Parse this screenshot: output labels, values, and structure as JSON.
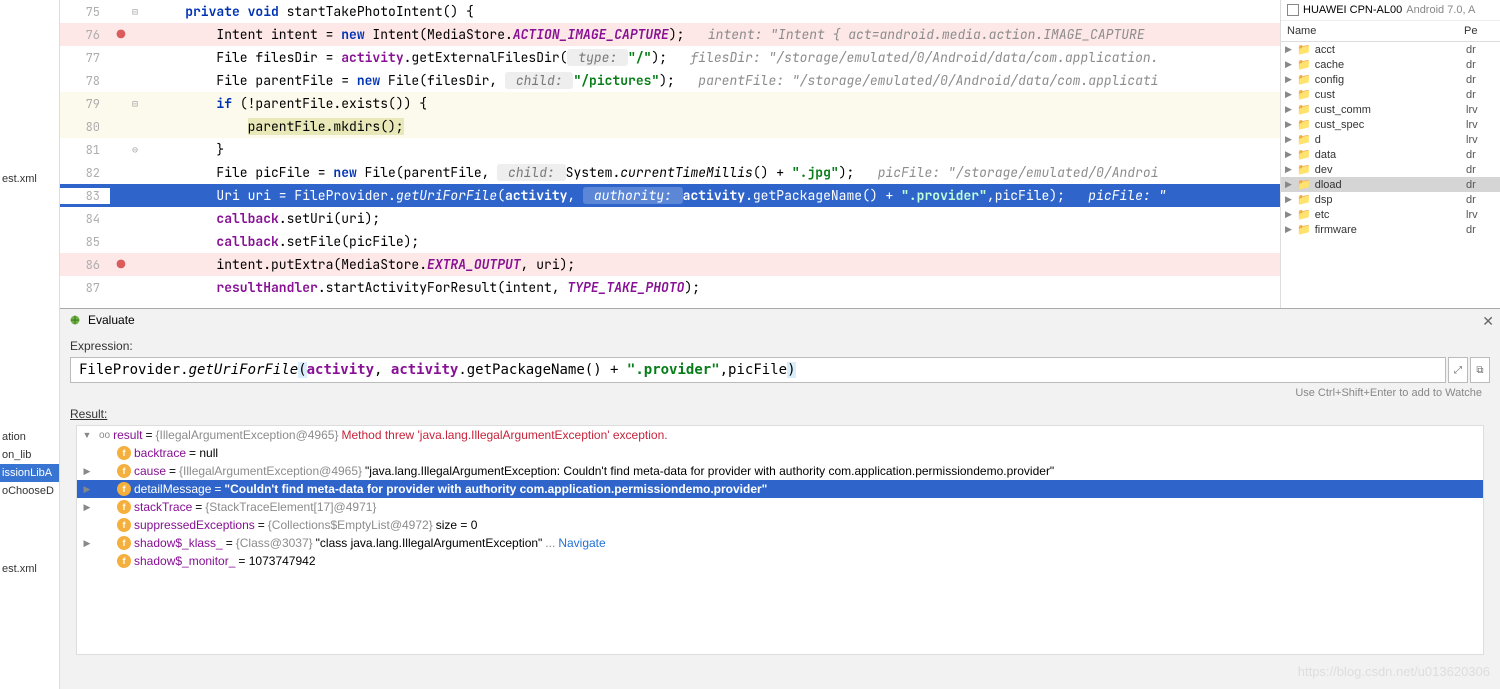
{
  "left_items_top": [
    "est.xml"
  ],
  "left_items_mid": [
    "ation",
    "on_lib",
    "issionLibA",
    "oChooseD"
  ],
  "left_items_bottom": [
    "est.xml"
  ],
  "code": {
    "lines": [
      {
        "num": 75,
        "fold": "⊟"
      },
      {
        "num": 76,
        "bp": true,
        "strike": true
      },
      {
        "num": 77
      },
      {
        "num": 78
      },
      {
        "num": 79,
        "hl": true,
        "fold": "⊟"
      },
      {
        "num": 80,
        "hl": true
      },
      {
        "num": 81,
        "fold": "⊖"
      },
      {
        "num": 82
      },
      {
        "num": 83,
        "sel": true
      },
      {
        "num": 84
      },
      {
        "num": 85
      },
      {
        "num": 86,
        "bp": true,
        "strike": true
      },
      {
        "num": 87
      }
    ],
    "t75_a": "private void",
    "t75_b": " startTakePhotoIntent() {",
    "t76_a": "Intent intent = ",
    "t76_b": "new",
    "t76_c": " Intent(MediaStore.",
    "t76_d": "ACTION_IMAGE_CAPTURE",
    "t76_e": ");   ",
    "t76_f": "intent: \"Intent { act=android.media.action.IMAGE_CAPTURE",
    "t77_a": "File filesDir = ",
    "t77_b": "activity",
    "t77_c": ".getExternalFilesDir(",
    "t77_d": " type: ",
    "t77_e": "\"/\"",
    "t77_f": ");   ",
    "t77_g": "filesDir: \"/storage/emulated/0/Android/data/com.application.",
    "t78_a": "File parentFile = ",
    "t78_b": "new",
    "t78_c": " File(filesDir, ",
    "t78_d": " child: ",
    "t78_e": "\"/pictures\"",
    "t78_f": ");   ",
    "t78_g": "parentFile: \"/storage/emulated/0/Android/data/com.applicati",
    "t79_a": "if",
    "t79_b": " (!parentFile.exists()) {",
    "t80_a": "parentFile.mkdirs();",
    "t81_a": "}",
    "t82_a": "File picFile = ",
    "t82_b": "new",
    "t82_c": " File(parentFile, ",
    "t82_d": " child: ",
    "t82_e": "System.",
    "t82_f": "currentTimeMillis",
    "t82_g": "() + ",
    "t82_h": "\".jpg\"",
    "t82_i": ");   ",
    "t82_j": "picFile: \"/storage/emulated/0/Androi",
    "t83_a": "Uri uri = FileProvider.",
    "t83_b": "getUriForFile",
    "t83_c": "(",
    "t83_d": "activity",
    "t83_e": ", ",
    "t83_f": " authority: ",
    "t83_g": "activity",
    "t83_h": ".getPackageName() + ",
    "t83_i": "\".provider\"",
    "t83_j": ",picFile);   ",
    "t83_k": "picFile: \"",
    "t84_a": "callback",
    "t84_b": ".setUri(uri);",
    "t85_a": "callback",
    "t85_b": ".setFile(picFile);",
    "t86_a": "intent.putExtra(MediaStore.",
    "t86_b": "EXTRA_OUTPUT",
    "t86_c": ", uri);",
    "t87_a": "resultHandler",
    "t87_b": ".startActivityForResult(intent, ",
    "t87_c": "TYPE_TAKE_PHOTO",
    "t87_d": ");"
  },
  "device": {
    "name": "HUAWEI CPN-AL00",
    "os": "Android 7.0, A"
  },
  "fs_header": {
    "c1": "Name",
    "c2": "Pe"
  },
  "fs": [
    {
      "name": "acct",
      "perm": "dr"
    },
    {
      "name": "cache",
      "perm": "dr"
    },
    {
      "name": "config",
      "perm": "dr"
    },
    {
      "name": "cust",
      "perm": "dr"
    },
    {
      "name": "cust_comm",
      "perm": "lrv"
    },
    {
      "name": "cust_spec",
      "perm": "lrv"
    },
    {
      "name": "d",
      "perm": "lrv"
    },
    {
      "name": "data",
      "perm": "dr"
    },
    {
      "name": "dev",
      "perm": "dr"
    },
    {
      "name": "dload",
      "perm": "dr",
      "sel": true
    },
    {
      "name": "dsp",
      "perm": "dr"
    },
    {
      "name": "etc",
      "perm": "lrv"
    },
    {
      "name": "firmware",
      "perm": "dr"
    }
  ],
  "eval": {
    "title": "Evaluate",
    "expr_label": "Expression:",
    "expr_a": "FileProvider.",
    "expr_b": "getUriForFile",
    "expr_c": "(",
    "expr_d": "activity",
    "expr_e": ", ",
    "expr_f": "activity",
    "expr_g": ".getPackageName() + ",
    "expr_h": "\".provider\"",
    "expr_i": ",picFile",
    "expr_j": ")",
    "hint": "Use Ctrl+Shift+Enter to add to Watche",
    "result_label": "Result:",
    "rows": [
      {
        "indent": 0,
        "arrow": "▼",
        "icon": "oo",
        "name": "result",
        "eq": " = ",
        "gray": "{IllegalArgumentException@4965}",
        "err": " Method threw 'java.lang.IllegalArgumentException' exception."
      },
      {
        "indent": 1,
        "arrow": "",
        "icon": "f",
        "name": "backtrace",
        "eq": " = null"
      },
      {
        "indent": 1,
        "arrow": "▶",
        "icon": "f",
        "name": "cause",
        "eq": " = ",
        "gray": "{IllegalArgumentException@4965}",
        "txt": " \"java.lang.IllegalArgumentException: Couldn't find meta-data for provider with authority com.application.permissiondemo.provider\""
      },
      {
        "indent": 1,
        "arrow": "▶",
        "icon": "f",
        "name": "detailMessage",
        "eq": " = ",
        "bold": "\"Couldn't find meta-data for provider with authority com.application.permissiondemo.provider\"",
        "sel": true
      },
      {
        "indent": 1,
        "arrow": "▶",
        "icon": "f",
        "name": "stackTrace",
        "eq": " = ",
        "gray": "{StackTraceElement[17]@4971}"
      },
      {
        "indent": 1,
        "arrow": "",
        "icon": "f",
        "name": "suppressedExceptions",
        "eq": " = ",
        "gray": "{Collections$EmptyList@4972}",
        "txt": "  size = 0"
      },
      {
        "indent": 1,
        "arrow": "▶",
        "icon": "f",
        "name": "shadow$_klass_",
        "eq": " = ",
        "gray": "{Class@3037}",
        "txt": " \"class java.lang.IllegalArgumentException\" ",
        "dots": "...",
        "link": " Navigate"
      },
      {
        "indent": 1,
        "arrow": "",
        "icon": "f",
        "name": "shadow$_monitor_",
        "eq": " = 1073747942"
      }
    ]
  },
  "watermark": "https://blog.csdn.net/u013620306"
}
